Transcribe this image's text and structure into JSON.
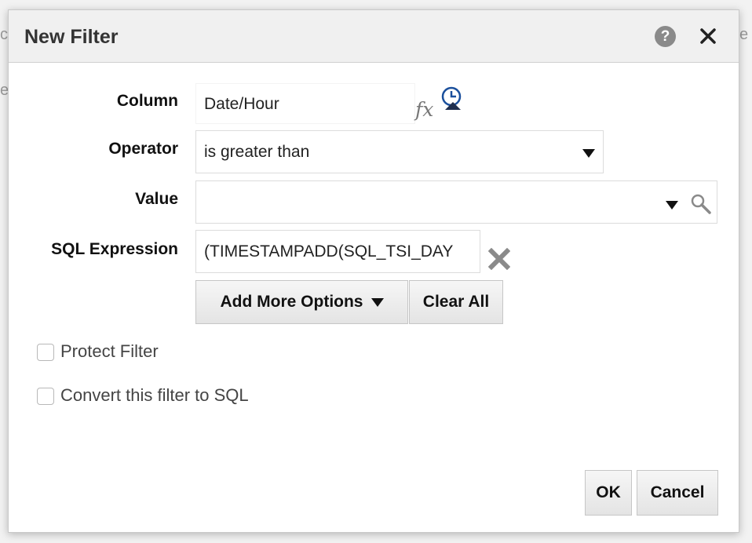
{
  "background": {
    "left_fragment_1": "c",
    "left_fragment_2": "e",
    "right_fragment": "e"
  },
  "dialog": {
    "title": "New Filter",
    "help_icon": "help-icon",
    "close_icon": "close-icon",
    "help_glyph": "?"
  },
  "form": {
    "column": {
      "label": "Column",
      "value": "Date/Hour",
      "fx": "fx"
    },
    "operator": {
      "label": "Operator",
      "selected": "is greater than"
    },
    "value": {
      "label": "Value",
      "text": ""
    },
    "sql_expression": {
      "label": "SQL Expression",
      "value": "(TIMESTAMPADD(SQL_TSI_DAY"
    }
  },
  "buttons": {
    "add_more_options": "Add More Options",
    "clear_all": "Clear All",
    "ok": "OK",
    "cancel": "Cancel"
  },
  "checkboxes": {
    "protect_filter": {
      "label": "Protect Filter",
      "checked": false
    },
    "convert_to_sql": {
      "label": "Convert this filter to SQL",
      "checked": false
    }
  },
  "colors": {
    "accent_blue": "#1a4f9c",
    "icon_gray": "#8a8a8a"
  }
}
